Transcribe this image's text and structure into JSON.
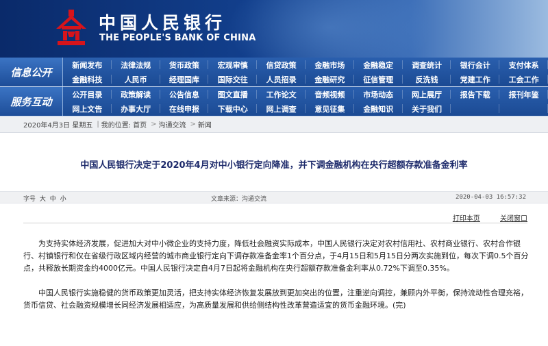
{
  "header": {
    "bank_name_cn": "中国人民银行",
    "bank_name_en": "THE PEOPLE'S BANK OF CHINA",
    "logo_icon": "pboc-emblem-icon",
    "brand_red": "#d7141b"
  },
  "nav": {
    "section1_label": "信息公开",
    "section2_label": "服务互动",
    "section1_items": [
      "新闻发布",
      "法律法规",
      "货币政策",
      "宏观审慎",
      "信贷政策",
      "金融市场",
      "金融稳定",
      "调查统计",
      "银行会计",
      "支付体系",
      "金融科技",
      "人民币",
      "经理国库",
      "国际交往",
      "人员招录",
      "金融研究",
      "征信管理",
      "反洗钱",
      "党建工作",
      "工会工作"
    ],
    "section2_items": [
      "公开目录",
      "政策解读",
      "公告信息",
      "图文直播",
      "工作论文",
      "音频视频",
      "市场动态",
      "网上展厅",
      "报告下载",
      "报刊年鉴",
      "网上文告",
      "办事大厅",
      "在线申报",
      "下载中心",
      "网上调查",
      "意见征集",
      "金融知识",
      "关于我们",
      "",
      ""
    ]
  },
  "breadcrumb": {
    "date": "2020年4月3日  星期五",
    "position_label": "我的位置:",
    "home": "首页",
    "level1": "沟通交流",
    "level2": "新闻"
  },
  "article": {
    "title": "中国人民银行决定于2020年4月对中小银行定向降准，并下调金融机构在央行超额存款准备金利率",
    "font_size_label": "字号",
    "font_large": "大",
    "font_medium": "中",
    "font_small": "小",
    "source": "文章来源：沟通交流",
    "datetime": "2020-04-03  16:57:32",
    "print_label": "打印本页",
    "close_label": "关闭窗口",
    "paragraph1": "为支持实体经济发展，促进加大对中小微企业的支持力度，降低社会融资实际成本，中国人民银行决定对农村信用社、农村商业银行、农村合作银行、村镇银行和仅在省级行政区域内经营的城市商业银行定向下调存款准备金率1个百分点，于4月15日和5月15日分两次实施到位，每次下调0.5个百分点，共释放长期资金约4000亿元。中国人民银行决定自4月7日起将金融机构在央行超额存款准备金利率从0.72%下调至0.35%。",
    "paragraph2": "中国人民银行实施稳健的货币政策更加灵活，把支持实体经济恢复发展放到更加突出的位置，注重逆向调控，兼顾内外平衡，保持流动性合理充裕，货币信贷、社会融资规模增长同经济发展相适应，为高质量发展和供给侧结构性改革营造适宜的货币金融环境。(完)"
  }
}
